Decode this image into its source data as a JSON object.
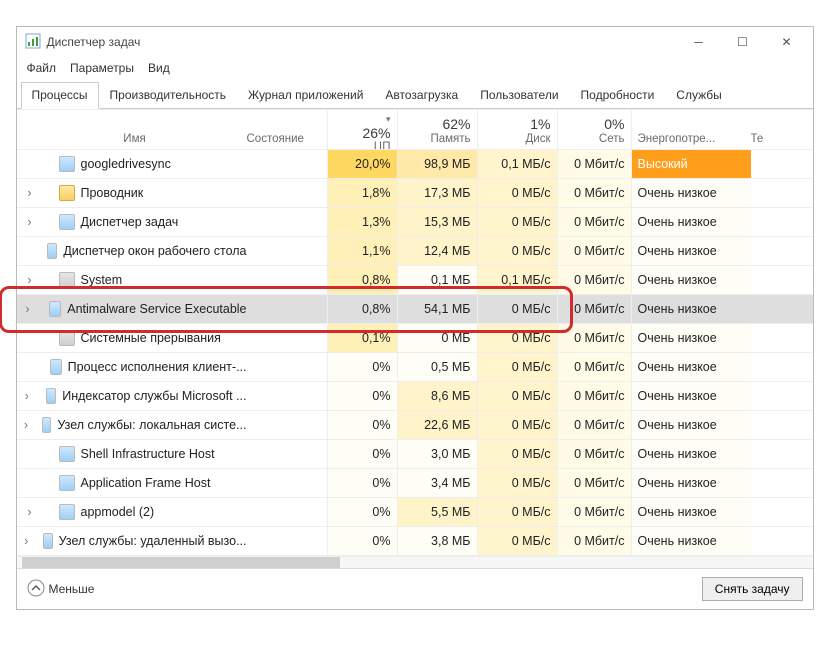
{
  "window": {
    "title": "Диспетчер задач"
  },
  "menus": [
    "Файл",
    "Параметры",
    "Вид"
  ],
  "tabs": [
    "Процессы",
    "Производительность",
    "Журнал приложений",
    "Автозагрузка",
    "Пользователи",
    "Подробности",
    "Службы"
  ],
  "active_tab": 0,
  "columns": {
    "name": "Имя",
    "state": "Состояние",
    "cpu": {
      "pct": "26%",
      "label": "ЦП"
    },
    "mem": {
      "pct": "62%",
      "label": "Память"
    },
    "disk": {
      "pct": "1%",
      "label": "Диск"
    },
    "net": {
      "pct": "0%",
      "label": "Сеть"
    },
    "power": "Энергопотре...",
    "tail": "Те"
  },
  "rows": [
    {
      "exp": "",
      "icon": "svc",
      "name": "googledrivesync",
      "cpu": "20,0%",
      "mem": "98,9 МБ",
      "disk": "0,1 МБ/с",
      "net": "0 Мбит/с",
      "power": "Высокий",
      "cpu_cls": "heat-cpu-hi",
      "mem_cls": "heat-mem",
      "pow_cls": "pow-hi"
    },
    {
      "exp": "›",
      "icon": "fold",
      "name": "Проводник",
      "cpu": "1,8%",
      "mem": "17,3 МБ",
      "disk": "0 МБ/с",
      "net": "0 Мбит/с",
      "power": "Очень низкое",
      "cpu_cls": "heat-cpu",
      "mem_cls": "heat-mem2",
      "pow_cls": "heat-none"
    },
    {
      "exp": "›",
      "icon": "svc",
      "name": "Диспетчер задач",
      "cpu": "1,3%",
      "mem": "15,3 МБ",
      "disk": "0 МБ/с",
      "net": "0 Мбит/с",
      "power": "Очень низкое",
      "cpu_cls": "heat-cpu",
      "mem_cls": "heat-mem2",
      "pow_cls": "heat-none"
    },
    {
      "exp": "",
      "icon": "svc",
      "name": "Диспетчер окон рабочего стола",
      "cpu": "1,1%",
      "mem": "12,4 МБ",
      "disk": "0 МБ/с",
      "net": "0 Мбит/с",
      "power": "Очень низкое",
      "cpu_cls": "heat-cpu",
      "mem_cls": "heat-mem2",
      "pow_cls": "heat-none"
    },
    {
      "exp": "›",
      "icon": "sys",
      "name": "System",
      "cpu": "0,8%",
      "mem": "0,1 МБ",
      "disk": "0,1 МБ/с",
      "net": "0 Мбит/с",
      "power": "Очень низкое",
      "cpu_cls": "heat-cpu",
      "mem_cls": "heat-none",
      "pow_cls": "heat-none"
    },
    {
      "exp": "›",
      "icon": "svc",
      "name": "Antimalware Service Executable",
      "cpu": "0,8%",
      "mem": "54,1 МБ",
      "disk": "0 МБ/с",
      "net": "0 Мбит/с",
      "power": "Очень низкое",
      "cpu_cls": "heat-cpu",
      "mem_cls": "heat-mem",
      "pow_cls": "heat-none",
      "selected": true
    },
    {
      "exp": "",
      "icon": "sys",
      "name": "Системные прерывания",
      "cpu": "0,1%",
      "mem": "0 МБ",
      "disk": "0 МБ/с",
      "net": "0 Мбит/с",
      "power": "Очень низкое",
      "cpu_cls": "heat-cpu",
      "mem_cls": "heat-none",
      "pow_cls": "heat-none"
    },
    {
      "exp": "",
      "icon": "svc",
      "name": "Процесс исполнения клиент-...",
      "cpu": "0%",
      "mem": "0,5 МБ",
      "disk": "0 МБ/с",
      "net": "0 Мбит/с",
      "power": "Очень низкое",
      "cpu_cls": "heat-none",
      "mem_cls": "heat-none",
      "pow_cls": "heat-none"
    },
    {
      "exp": "›",
      "icon": "svc",
      "name": "Индексатор службы Microsoft ...",
      "cpu": "0%",
      "mem": "8,6 МБ",
      "disk": "0 МБ/с",
      "net": "0 Мбит/с",
      "power": "Очень низкое",
      "cpu_cls": "heat-none",
      "mem_cls": "heat-mem2",
      "pow_cls": "heat-none"
    },
    {
      "exp": "›",
      "icon": "svc",
      "name": "Узел службы: локальная систе...",
      "cpu": "0%",
      "mem": "22,6 МБ",
      "disk": "0 МБ/с",
      "net": "0 Мбит/с",
      "power": "Очень низкое",
      "cpu_cls": "heat-none",
      "mem_cls": "heat-mem2",
      "pow_cls": "heat-none"
    },
    {
      "exp": "",
      "icon": "svc",
      "name": "Shell Infrastructure Host",
      "cpu": "0%",
      "mem": "3,0 МБ",
      "disk": "0 МБ/с",
      "net": "0 Мбит/с",
      "power": "Очень низкое",
      "cpu_cls": "heat-none",
      "mem_cls": "heat-none",
      "pow_cls": "heat-none"
    },
    {
      "exp": "",
      "icon": "svc",
      "name": "Application Frame Host",
      "cpu": "0%",
      "mem": "3,4 МБ",
      "disk": "0 МБ/с",
      "net": "0 Мбит/с",
      "power": "Очень низкое",
      "cpu_cls": "heat-none",
      "mem_cls": "heat-none",
      "pow_cls": "heat-none"
    },
    {
      "exp": "›",
      "icon": "svc",
      "name": "appmodel (2)",
      "cpu": "0%",
      "mem": "5,5 МБ",
      "disk": "0 МБ/с",
      "net": "0 Мбит/с",
      "power": "Очень низкое",
      "cpu_cls": "heat-none",
      "mem_cls": "heat-mem2",
      "pow_cls": "heat-none"
    },
    {
      "exp": "›",
      "icon": "svc",
      "name": "Узел службы: удаленный вызо...",
      "cpu": "0%",
      "mem": "3,8 МБ",
      "disk": "0 МБ/с",
      "net": "0 Мбит/с",
      "power": "Очень низкое",
      "cpu_cls": "heat-none",
      "mem_cls": "heat-none",
      "pow_cls": "heat-none"
    }
  ],
  "footer": {
    "fewer": "Меньше",
    "end_task": "Снять задачу"
  }
}
